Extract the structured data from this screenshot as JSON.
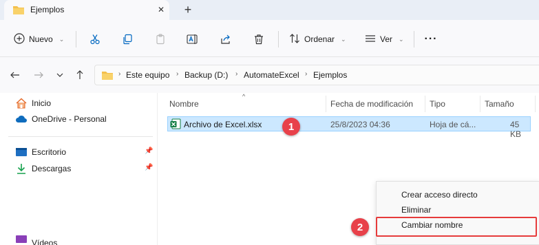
{
  "tab": {
    "title": "Ejemplos",
    "close_glyph": "✕",
    "new_tab_glyph": "+"
  },
  "toolbar": {
    "new_label": "Nuevo",
    "sort_label": "Ordenar",
    "view_label": "Ver",
    "more_glyph": "···",
    "chevron": "⌄"
  },
  "address": {
    "crumbs": [
      "Este equipo",
      "Backup (D:)",
      "AutomateExcel",
      "Ejemplos"
    ],
    "separator": "›"
  },
  "nav": {
    "home": "Inicio",
    "onedrive": "OneDrive - Personal",
    "desktop": "Escritorio",
    "downloads": "Descargas",
    "videos": "Vídeos",
    "pin_glyph": "📌"
  },
  "columns": {
    "name": "Nombre",
    "modified": "Fecha de modificación",
    "type": "Tipo",
    "size": "Tamaño",
    "sort_glyph": "^"
  },
  "file": {
    "name": "Archivo de Excel.xlsx",
    "modified": "25/8/2023 04:36",
    "type": "Hoja de cá...",
    "size": "45 KB"
  },
  "context_menu": {
    "items": [
      "Crear acceso directo",
      "Eliminar",
      "Cambiar nombre"
    ]
  },
  "badges": {
    "one": "1",
    "two": "2"
  },
  "colors": {
    "accent": "#0067c0",
    "highlight_red": "#e63b3b",
    "selection": "#cce8ff",
    "folder": "#f4c04d",
    "excel": "#107c41"
  }
}
